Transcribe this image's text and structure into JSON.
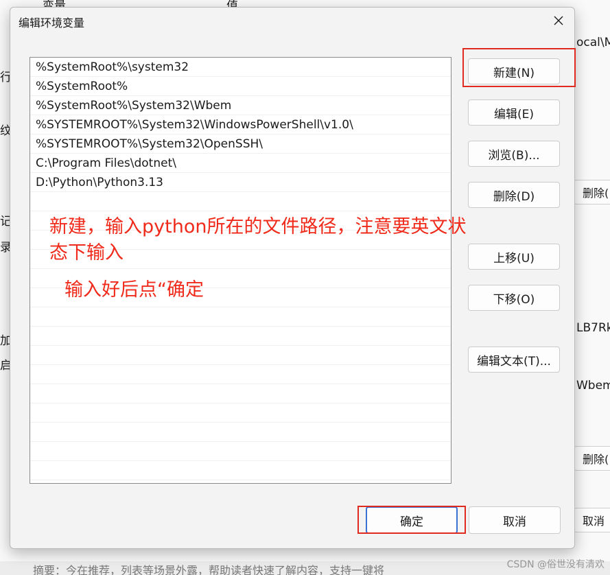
{
  "background": {
    "header_left": "变量",
    "header_right": "值",
    "fragments": [
      "ocal\\Mi",
      "LB7Rk",
      "Wbem",
      "行",
      "纹",
      "记",
      "录",
      "加",
      "启"
    ],
    "delete_label": "删除(",
    "cancel_label": "取消",
    "footer_text": "摘要：今在推荐，列表等场景外露，帮助读者快速了解内容，支持一键将"
  },
  "dialog": {
    "title": "编辑环境变量",
    "paths": [
      "%SystemRoot%\\system32",
      "%SystemRoot%",
      "%SystemRoot%\\System32\\Wbem",
      "%SYSTEMROOT%\\System32\\WindowsPowerShell\\v1.0\\",
      "%SYSTEMROOT%\\System32\\OpenSSH\\",
      "C:\\Program Files\\dotnet\\",
      "D:\\Python\\Python3.13"
    ],
    "buttons": {
      "new": "新建(N)",
      "edit": "编辑(E)",
      "browse": "浏览(B)...",
      "delete": "删除(D)",
      "move_up": "上移(U)",
      "move_down": "下移(O)",
      "edit_text": "编辑文本(T)...",
      "ok": "确定",
      "cancel": "取消"
    }
  },
  "annotations": {
    "line1": "新建，输入python所在的文件路径，注意要英文状",
    "line2": "态下输入",
    "line3": "输入好后点“确定"
  },
  "watermark": "CSDN @俗世没有清欢",
  "colors": {
    "annotation_red": "#f02a1a",
    "highlight_red": "#e0291f",
    "focus_blue": "#3b6fd0"
  }
}
